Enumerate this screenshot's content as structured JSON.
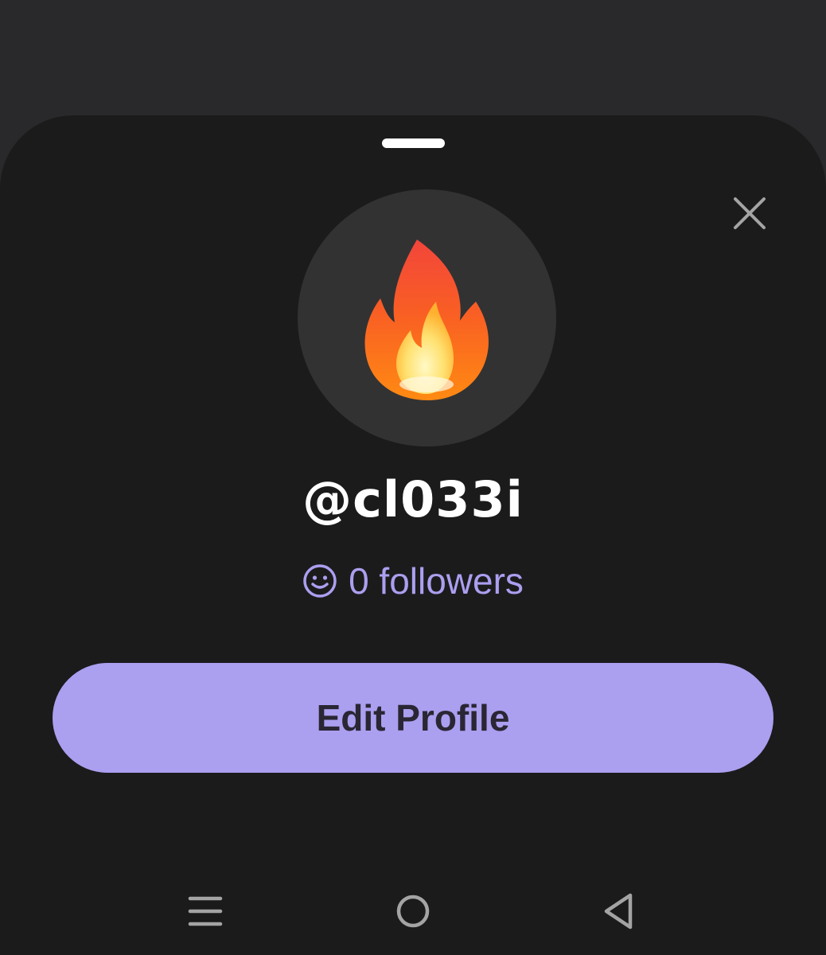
{
  "profile_sheet": {
    "username": "@cl033i",
    "followers_text": "0 followers",
    "avatar_emoji": "fire",
    "edit_button_label": "Edit Profile"
  },
  "icons": {
    "close": "close-icon",
    "followers": "smiley-icon",
    "nav_recents": "recents-icon",
    "nav_home": "home-icon",
    "nav_back": "back-icon"
  },
  "colors": {
    "page_background": "#29292b",
    "sheet_background": "#1b1b1c",
    "avatar_background": "#323233",
    "accent": "#ab9ff0",
    "button_text": "#2a2633",
    "text_primary": "#ffffff",
    "icon_gray": "#a4a4a4"
  }
}
